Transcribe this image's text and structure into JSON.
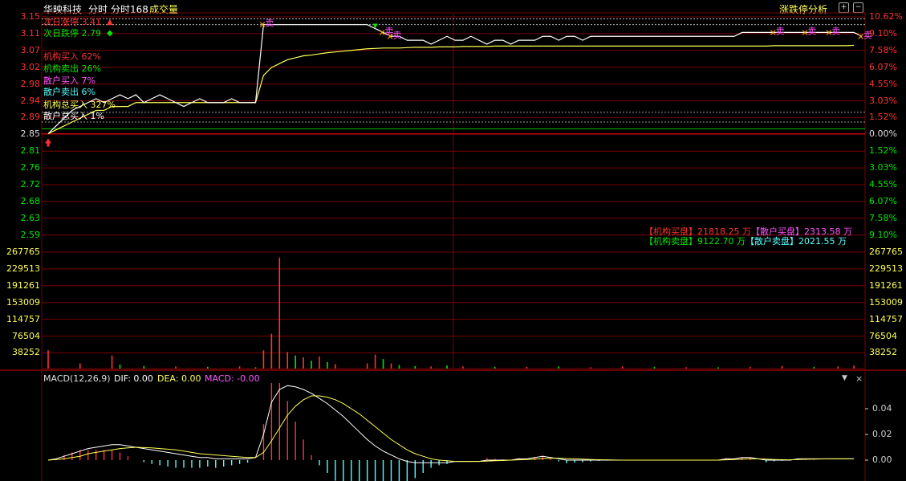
{
  "header": {
    "stock_name": "华映科技",
    "view_intraday": "分时",
    "view_intraday168": "分时168",
    "volume_label": "成交量",
    "analysis_button": "涨跌停分析"
  },
  "overlay": {
    "next_limit_up": "次日涨停 3.41",
    "next_limit_down": "次日跌停 2.79",
    "inst_buy": "机构买入 62%",
    "inst_sell": "机构卖出 26%",
    "retail_buy": "散户买入 7%",
    "retail_sell": "散户卖出 6%",
    "inst_total_buy": "机构总买入 327%",
    "retail_total_buy": "散户总买入 1%"
  },
  "panel": {
    "inst_buy_label": "【机构买盘】",
    "inst_buy_value": "21818.25 万",
    "retail_buy_label": "【散户买盘】",
    "retail_buy_value": "2313.58 万",
    "inst_sell_label": "【机构卖盘】",
    "inst_sell_value": "9122.70 万",
    "retail_sell_label": "【散户卖盘】",
    "retail_sell_value": "2021.55 万"
  },
  "markers": {
    "sell_char": "卖"
  },
  "macd": {
    "title": "MACD(12,26,9)",
    "dif": "DIF: 0.00",
    "dea": "DEA: 0.00",
    "macd": "MACD: -0.00",
    "yticks": [
      "0.04",
      "0.02",
      "0.00"
    ]
  },
  "axes": {
    "price_left": [
      "3.15",
      "3.11",
      "3.07",
      "3.02",
      "2.98",
      "2.94",
      "2.89",
      "2.85",
      "2.81",
      "2.76",
      "2.72",
      "2.68",
      "2.63",
      "2.59"
    ],
    "pct_right": [
      "10.62%",
      "9.10%",
      "7.58%",
      "6.07%",
      "4.55%",
      "3.03%",
      "1.52%",
      "0.00%",
      "1.52%",
      "3.03%",
      "4.55%",
      "6.07%",
      "7.58%",
      "9.10%"
    ],
    "volume": [
      "267765",
      "229513",
      "191261",
      "153009",
      "114757",
      "76504",
      "38252"
    ]
  },
  "colors": {
    "up": "#ff3232",
    "down": "#00e600",
    "grid": "#7a0000",
    "price": "#ffffff",
    "avg": "#ffff55",
    "magenta": "#ff55ff",
    "cyan": "#55ffff",
    "orange": "#ffaa00"
  },
  "chart_data": {
    "type": "line",
    "prev_close": 2.85,
    "limit_up": 3.13,
    "price_ylim": [
      2.57,
      3.15
    ],
    "series": [
      {
        "values": [
          2.85,
          2.87,
          2.89,
          2.91,
          2.92,
          2.93,
          2.94,
          2.93,
          2.94,
          2.95,
          2.94,
          2.95,
          2.93,
          2.94,
          2.95,
          2.94,
          2.93,
          2.92,
          2.93,
          2.94,
          2.93,
          2.93,
          2.93,
          2.94,
          2.93,
          2.93,
          2.93,
          3.13,
          3.13,
          3.13,
          3.13,
          3.13,
          3.13,
          3.13,
          3.13,
          3.13,
          3.13,
          3.13,
          3.13,
          3.13,
          3.13,
          3.12,
          3.11,
          3.1,
          3.1,
          3.09,
          3.09,
          3.09,
          3.08,
          3.09,
          3.1,
          3.09,
          3.09,
          3.1,
          3.09,
          3.08,
          3.09,
          3.09,
          3.08,
          3.09,
          3.09,
          3.09,
          3.1,
          3.1,
          3.09,
          3.1,
          3.1,
          3.09,
          3.1,
          3.1,
          3.1,
          3.1,
          3.1,
          3.1,
          3.1,
          3.1,
          3.1,
          3.1,
          3.1,
          3.1,
          3.1,
          3.1,
          3.1,
          3.1,
          3.1,
          3.1,
          3.1,
          3.11,
          3.11,
          3.11,
          3.11,
          3.11,
          3.11,
          3.11,
          3.11,
          3.11,
          3.11,
          3.11,
          3.11,
          3.11,
          3.11,
          3.11,
          3.1
        ]
      },
      {
        "values": [
          2.85,
          2.86,
          2.87,
          2.88,
          2.89,
          2.9,
          2.91,
          2.91,
          2.92,
          2.92,
          2.92,
          2.93,
          2.93,
          2.93,
          2.93,
          2.93,
          2.93,
          2.93,
          2.93,
          2.93,
          2.93,
          2.93,
          2.93,
          2.93,
          2.93,
          2.93,
          2.93,
          3.0,
          3.02,
          3.03,
          3.04,
          3.045,
          3.05,
          3.052,
          3.055,
          3.058,
          3.06,
          3.062,
          3.064,
          3.066,
          3.068,
          3.069,
          3.07,
          3.07,
          3.07,
          3.071,
          3.072,
          3.072,
          3.072,
          3.073,
          3.073,
          3.073,
          3.074,
          3.074,
          3.074,
          3.074,
          3.075,
          3.075,
          3.075,
          3.075,
          3.075,
          3.075,
          3.075,
          3.075,
          3.075,
          3.075,
          3.075,
          3.075,
          3.075,
          3.075,
          3.075,
          3.075,
          3.075,
          3.075,
          3.075,
          3.075,
          3.075,
          3.075,
          3.075,
          3.075,
          3.075,
          3.075,
          3.075,
          3.075,
          3.075,
          3.075,
          3.075,
          3.075,
          3.075,
          3.075,
          3.075,
          3.076,
          3.076,
          3.076,
          3.076,
          3.076,
          3.076,
          3.076,
          3.076,
          3.076,
          3.076,
          3.077
        ]
      }
    ],
    "volume": [
      {
        "i": 0,
        "v": 42000,
        "u": 1
      },
      {
        "i": 4,
        "v": 12000,
        "u": 1
      },
      {
        "i": 8,
        "v": 30000,
        "u": 1
      },
      {
        "i": 9,
        "v": 9000,
        "u": 0
      },
      {
        "i": 12,
        "v": 6000,
        "u": 0
      },
      {
        "i": 16,
        "v": 5000,
        "u": 1
      },
      {
        "i": 20,
        "v": 4000,
        "u": 0
      },
      {
        "i": 24,
        "v": 5000,
        "u": 1
      },
      {
        "i": 26,
        "v": 3000,
        "u": 0
      },
      {
        "i": 27,
        "v": 42000,
        "u": 1
      },
      {
        "i": 28,
        "v": 80000,
        "u": 1
      },
      {
        "i": 29,
        "v": 255000,
        "u": 1
      },
      {
        "i": 30,
        "v": 38000,
        "u": 1
      },
      {
        "i": 31,
        "v": 30000,
        "u": 0
      },
      {
        "i": 32,
        "v": 26000,
        "u": 1
      },
      {
        "i": 33,
        "v": 18000,
        "u": 0
      },
      {
        "i": 34,
        "v": 28000,
        "u": 1
      },
      {
        "i": 35,
        "v": 15000,
        "u": 0
      },
      {
        "i": 36,
        "v": 10000,
        "u": 1
      },
      {
        "i": 40,
        "v": 12000,
        "u": 1
      },
      {
        "i": 41,
        "v": 32000,
        "u": 1
      },
      {
        "i": 42,
        "v": 22000,
        "u": 0
      },
      {
        "i": 43,
        "v": 12000,
        "u": 1
      },
      {
        "i": 44,
        "v": 8000,
        "u": 0
      },
      {
        "i": 46,
        "v": 6000,
        "u": 0
      },
      {
        "i": 48,
        "v": 5000,
        "u": 1
      },
      {
        "i": 50,
        "v": 7000,
        "u": 0
      },
      {
        "i": 52,
        "v": 5000,
        "u": 1
      },
      {
        "i": 56,
        "v": 4000,
        "u": 0
      },
      {
        "i": 60,
        "v": 4000,
        "u": 1
      },
      {
        "i": 64,
        "v": 5000,
        "u": 0
      },
      {
        "i": 68,
        "v": 3000,
        "u": 1
      },
      {
        "i": 72,
        "v": 5000,
        "u": 1
      },
      {
        "i": 76,
        "v": 4000,
        "u": 0
      },
      {
        "i": 80,
        "v": 3000,
        "u": 1
      },
      {
        "i": 84,
        "v": 3000,
        "u": 0
      },
      {
        "i": 88,
        "v": 4000,
        "u": 1
      },
      {
        "i": 92,
        "v": 6000,
        "u": 1
      },
      {
        "i": 96,
        "v": 4000,
        "u": 0
      },
      {
        "i": 99,
        "v": 5000,
        "u": 1
      },
      {
        "i": 101,
        "v": 7000,
        "u": 1
      }
    ],
    "macd": {
      "dif": [
        0,
        0.001,
        0.003,
        0.005,
        0.007,
        0.009,
        0.01,
        0.011,
        0.012,
        0.012,
        0.011,
        0.01,
        0.009,
        0.008,
        0.007,
        0.006,
        0.005,
        0.004,
        0.003,
        0.002,
        0.002,
        0.001,
        0.001,
        0.001,
        0.001,
        0.001,
        0.002,
        0.02,
        0.045,
        0.055,
        0.058,
        0.057,
        0.055,
        0.052,
        0.048,
        0.044,
        0.039,
        0.034,
        0.028,
        0.022,
        0.016,
        0.011,
        0.007,
        0.004,
        0.001,
        -0.001,
        -0.002,
        -0.002,
        -0.002,
        -0.002,
        -0.002,
        -0.001,
        -0.001,
        -0.001,
        -0.001,
        0,
        0,
        0,
        0,
        0.001,
        0.001,
        0.002,
        0.003,
        0.002,
        0.001,
        0,
        0,
        0,
        0,
        0,
        0,
        0,
        0,
        0,
        0,
        0,
        0,
        0,
        0,
        0,
        0,
        0,
        0,
        0,
        0,
        0.001,
        0.001,
        0.002,
        0.002,
        0.001,
        0,
        0,
        0,
        0,
        0.001,
        0.001,
        0.001,
        0.001,
        0.001,
        0.001,
        0.001,
        0.001
      ],
      "dea": [
        0,
        0.0005,
        0.001,
        0.002,
        0.003,
        0.005,
        0.006,
        0.007,
        0.008,
        0.009,
        0.0095,
        0.01,
        0.0098,
        0.0095,
        0.009,
        0.0085,
        0.008,
        0.007,
        0.006,
        0.005,
        0.0045,
        0.004,
        0.0035,
        0.003,
        0.0025,
        0.002,
        0.002,
        0.006,
        0.015,
        0.025,
        0.035,
        0.042,
        0.047,
        0.05,
        0.05,
        0.049,
        0.047,
        0.044,
        0.04,
        0.036,
        0.031,
        0.026,
        0.021,
        0.016,
        0.012,
        0.008,
        0.005,
        0.003,
        0.001,
        0,
        -0.0005,
        -0.001,
        -0.001,
        -0.001,
        -0.001,
        -0.0008,
        -0.0005,
        -0.0003,
        0,
        0.0002,
        0.0005,
        0.0008,
        0.0012,
        0.0015,
        0.0015,
        0.0012,
        0.001,
        0.0008,
        0.0005,
        0.0003,
        0.0002,
        0.0001,
        0,
        0,
        0,
        0,
        0,
        0,
        0,
        0,
        0,
        0,
        0,
        0,
        0,
        0.0002,
        0.0005,
        0.0008,
        0.001,
        0.001,
        0.0008,
        0.0005,
        0.0003,
        0.0002,
        0.0005,
        0.0007,
        0.0008,
        0.0009,
        0.001,
        0.001,
        0.001,
        0.001
      ],
      "ylim": [
        -0.015,
        0.06
      ]
    },
    "sell_marker_indices": [
      27,
      42,
      43,
      91,
      95,
      98,
      102
    ],
    "buy_marker_indices": [
      0
    ],
    "green_marker_indices": [
      41
    ]
  }
}
